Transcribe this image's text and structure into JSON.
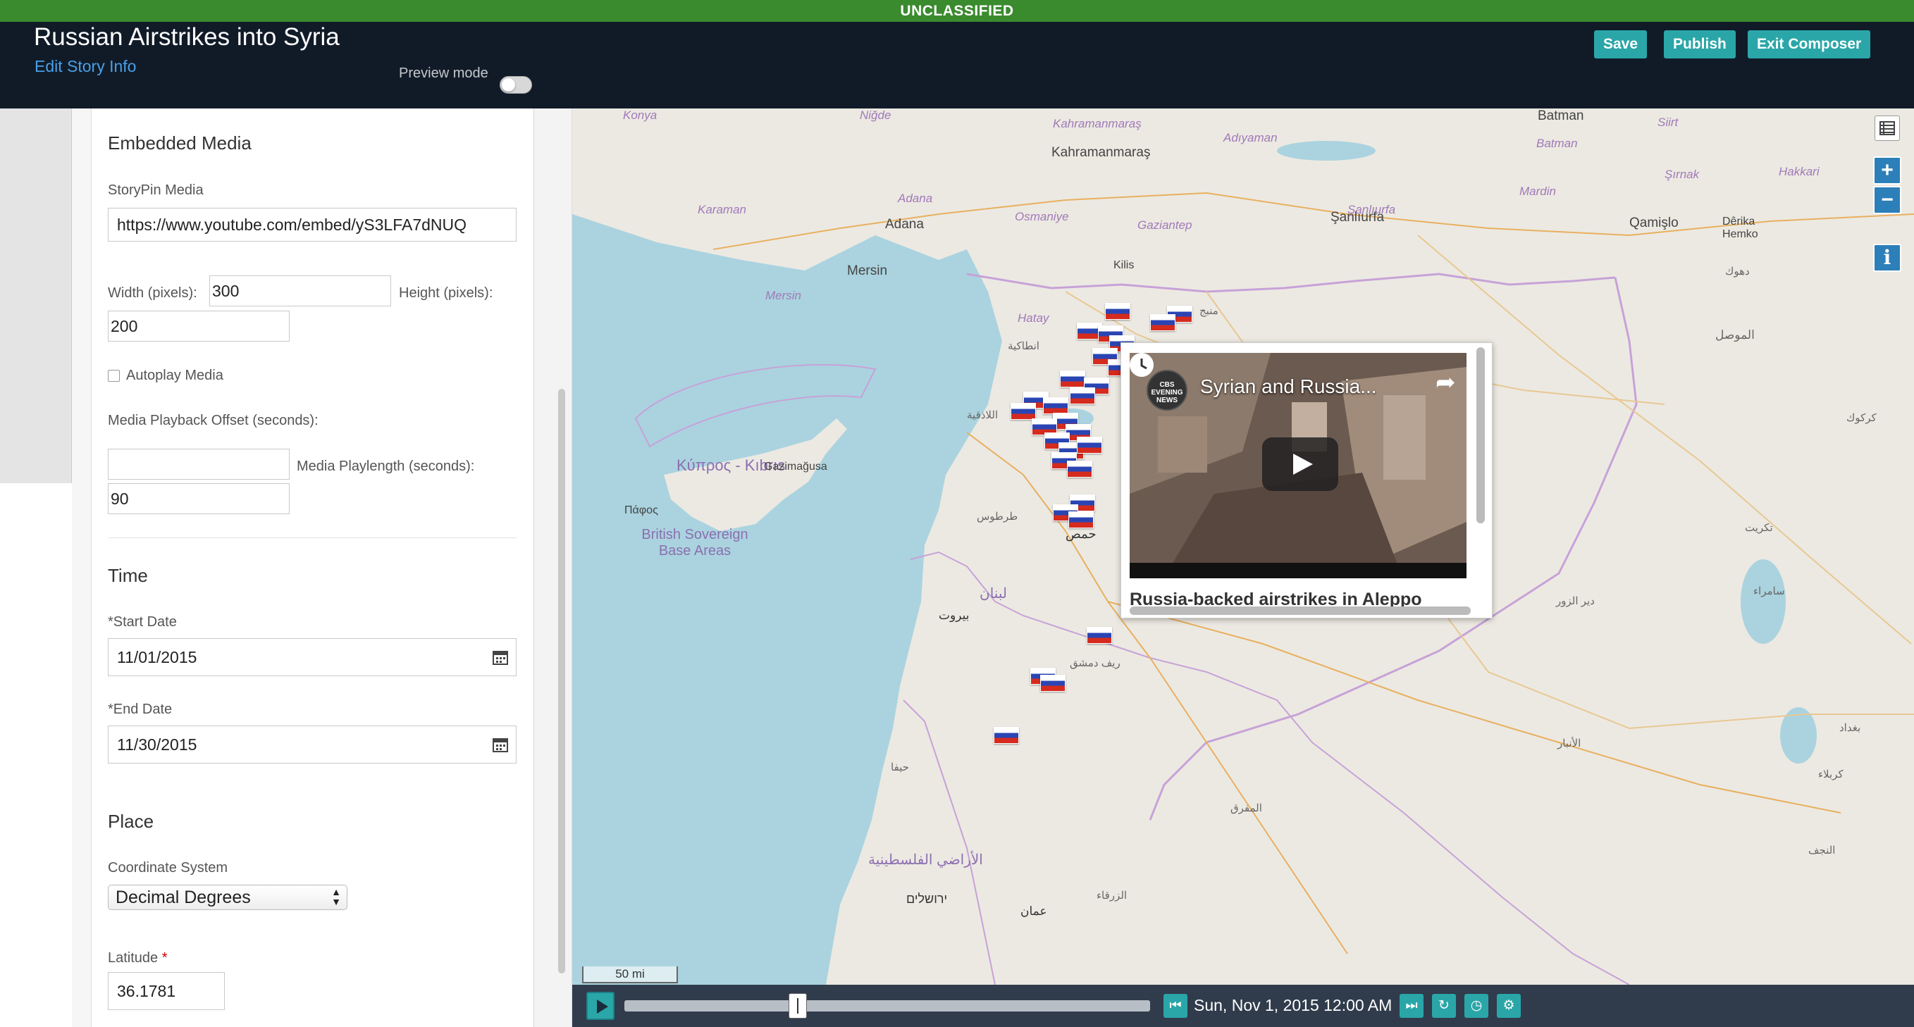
{
  "banner": {
    "classification": "UNCLASSIFIED"
  },
  "header": {
    "title": "Russian Airstrikes into Syria",
    "edit_link": "Edit Story Info",
    "preview_label": "Preview mode",
    "preview_enabled": false,
    "buttons": {
      "save": "Save",
      "publish": "Publish",
      "exit": "Exit Composer"
    },
    "accent_color": "#2aa6a8"
  },
  "form": {
    "embedded_media": {
      "heading": "Embedded Media",
      "storypin_media_label": "StoryPin Media",
      "storypin_media_value": "https://www.youtube.com/embed/yS3LFA7dNUQ",
      "width_label": "Width (pixels):",
      "width_value": "300",
      "height_label": "Height (pixels):",
      "height_value": "200",
      "autoplay_label": "Autoplay Media",
      "autoplay_checked": false,
      "offset_label": "Media Playback Offset (seconds):",
      "offset_value": "",
      "playlength_label": "Media Playlength (seconds):",
      "playlength_value": "90"
    },
    "time": {
      "heading": "Time",
      "start_label": "*Start Date",
      "start_value": "11/01/2015",
      "end_label": "*End Date",
      "end_value": "11/30/2015"
    },
    "place": {
      "heading": "Place",
      "coord_label": "Coordinate System",
      "coord_value": "Decimal Degrees",
      "latitude_label": "Latitude",
      "latitude_required": "*",
      "latitude_value": "36.1781"
    }
  },
  "map": {
    "labels": {
      "konya": "Konya",
      "nigde": "Niğde",
      "kahramanmaras_region": "Kahramanmaraş",
      "kahramanmaras": "Kahramanmaraş",
      "adiyaman": "Adıyaman",
      "batman": "Batman",
      "batman_region": "Batman",
      "siirt": "Siirt",
      "sirnak": "Şırnak",
      "hakkari": "Hakkari",
      "karaman": "Karaman",
      "adana_region": "Adana",
      "adana": "Adana",
      "osmaniye": "Osmaniye",
      "gaziantep": "Gaziantep",
      "sanliurfa": "Şanlıurfa",
      "sanliurfa_region": "Şanlıurfa",
      "mardin": "Mardin",
      "qamishli": "Qamişlo",
      "derika": "Dêrika Hemko",
      "mersin": "Mersin",
      "mersin_region": "Mersin",
      "kilis": "Kilis",
      "hatay": "Hatay",
      "cyprus": "Κύπρος - Kıbrıs",
      "gazimagusa": "Gazimağusa",
      "pafos": "Πάφος",
      "british_bases": "British Sovereign Base Areas",
      "mosul": "الموصل",
      "dohuk": "دهوك",
      "homs": "حمص",
      "beirut": "بيروت",
      "lebanon": "لبنان",
      "damascus": "ريف دمشق",
      "jerusalem": "ירושלים",
      "israel_region": "الأراضي الفلسطينية",
      "amman": "عمان",
      "baghdad": "بغداد",
      "latakia": "اللاذقية",
      "tartus": "طرطوس",
      "antakya": "انطاكية",
      "manbij": "منبج",
      "kirkuk": "كركوك",
      "tikrit": "تكريت",
      "anbar": "الأنبار",
      "samarra": "سامراء",
      "karbala": "كربلاء",
      "najaf": "النجف",
      "haifa": "حيفا",
      "mafraq": "المفرق",
      "zarqa": "الزرقاء",
      "tobruk": "دير الزور"
    },
    "popup": {
      "video_title": "Syrian and Russia...",
      "channel": "CBS EVENING NEWS",
      "caption": "Russia-backed airstrikes in Aleppo"
    },
    "scale": "50 mi",
    "icons": {
      "zoom_in": "+",
      "zoom_out": "−",
      "info": "i"
    }
  },
  "timeline": {
    "current_date": "Sun, Nov 1, 2015 12:00 AM",
    "progress": 0.33
  }
}
